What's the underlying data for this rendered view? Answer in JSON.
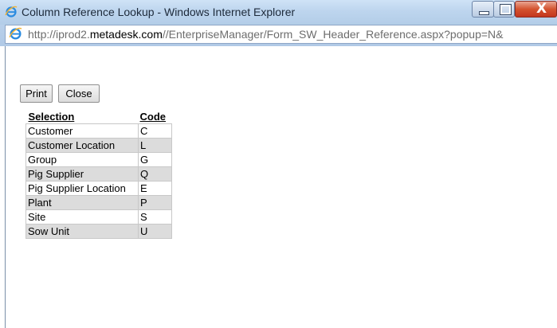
{
  "window": {
    "title": "Column Reference Lookup - Windows Internet Explorer",
    "close_glyph": "X"
  },
  "address": {
    "url_prefix": "http://iprod2.",
    "url_domain": "metadesk.com",
    "url_suffix": "//EnterpriseManager/Form_SW_Header_Reference.aspx?popup=N&"
  },
  "toolbar": {
    "print_label": "Print",
    "close_label": "Close"
  },
  "table": {
    "headers": [
      "Selection",
      "Code"
    ],
    "rows": [
      {
        "selection": "Customer",
        "code": "C"
      },
      {
        "selection": "Customer Location",
        "code": "L"
      },
      {
        "selection": "Group",
        "code": "G"
      },
      {
        "selection": "Pig Supplier",
        "code": "Q"
      },
      {
        "selection": "Pig Supplier Location",
        "code": "E"
      },
      {
        "selection": "Plant",
        "code": "P"
      },
      {
        "selection": "Site",
        "code": "S"
      },
      {
        "selection": "Sow Unit",
        "code": "U"
      }
    ]
  },
  "colors": {
    "row_alt": "#dcdcdc",
    "titlebar": "#bdd5ee",
    "close_button": "#c3361e"
  },
  "icons": [
    "ie-logo-icon",
    "minimize-icon",
    "maximize-icon",
    "close-icon"
  ]
}
